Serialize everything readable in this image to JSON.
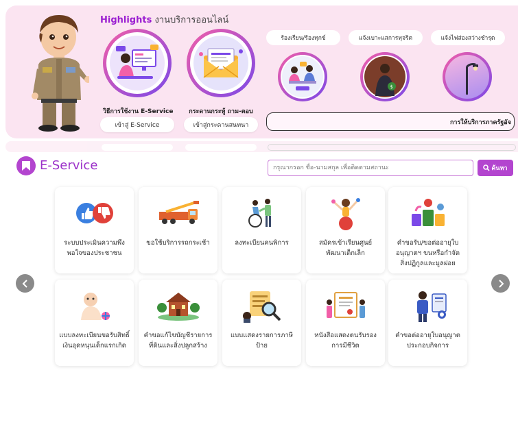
{
  "highlights": {
    "title_accent": "Highlights",
    "title_rest": " งานบริการออนไลน์",
    "cards": [
      {
        "label": "วิธีการใช้งาน E-Service",
        "button": "เข้าสู่ E-Service",
        "icon": "computer-user-icon"
      },
      {
        "label": "กระดานกระทู้ ถาม-ตอบ",
        "button": "เข้าสู่กระดานสนทนา",
        "icon": "envelope-icon"
      }
    ],
    "topics": [
      {
        "label": "ร้องเรียน/ร้องทุกข์",
        "icon": "complaint-meeting-icon"
      },
      {
        "label": "แจ้งเบาะแสการทุจริต",
        "icon": "corruption-icon"
      },
      {
        "label": "แจ้งไฟส่องสว่างชำรุด",
        "icon": "street-lamp-icon"
      }
    ],
    "gov_service": "การให้บริการภาครัฐอัจ"
  },
  "eservice": {
    "title": "E-Service",
    "search_placeholder": "กรุณากรอก ชื่อ-นามสกุล เพื่อติดตามสถานะ",
    "search_button": "ค้นหา",
    "items": [
      {
        "label": "ระบบประเมินความพึงพอใจของประชาชน",
        "icon": "thumbs-rating-icon"
      },
      {
        "label": "ขอใช้บริการรถกระเช้า",
        "icon": "crane-truck-icon"
      },
      {
        "label": "ลงทะเบียนคนพิการ",
        "icon": "wheelchair-icon"
      },
      {
        "label": "สมัครเข้าเรียนศูนย์พัฒนาเด็กเล็ก",
        "icon": "child-play-icon"
      },
      {
        "label": "คำขอรับ/ขอต่ออายุใบอนุญาตฯ ขนหรือกำจัดสิ่งปฏิกูลและมูลฝอย",
        "icon": "waste-icon"
      },
      {
        "label": "แบบลงทะเบียนขอรับสิทธิ์เงินอุดหนุนเด็กแรกเกิด",
        "icon": "baby-icon"
      },
      {
        "label": "คำขอแก้ไขบัญชีรายการที่ดินและสิ่งปลูกสร้าง",
        "icon": "land-building-icon"
      },
      {
        "label": "แบบแสดงรายการภาษีป้าย",
        "icon": "tax-sign-icon"
      },
      {
        "label": "หนังสือแสดงตนรับรองการมีชีวิต",
        "icon": "certificate-icon"
      },
      {
        "label": "คำขอต่ออายุใบอนุญาตประกอบกิจการ",
        "icon": "business-license-icon"
      }
    ]
  },
  "colors": {
    "accent": "#b345cf",
    "banner_bg": "#fbe4f1",
    "ring_start": "#f25fa8",
    "ring_end": "#7b49e8"
  }
}
